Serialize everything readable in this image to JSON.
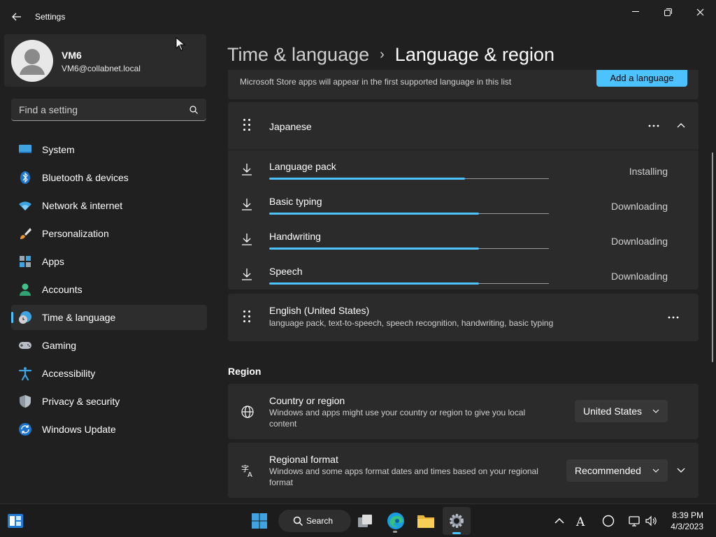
{
  "window": {
    "title": "Settings",
    "colors": {
      "accent": "#4cc2ff",
      "background": "#202020",
      "card": "#2b2b2b"
    }
  },
  "profile": {
    "name": "VM6",
    "email": "VM6@collabnet.local"
  },
  "search": {
    "placeholder": "Find a setting"
  },
  "sidebar": {
    "items": [
      {
        "label": "System",
        "icon": "system-monitor-icon"
      },
      {
        "label": "Bluetooth & devices",
        "icon": "bluetooth-icon"
      },
      {
        "label": "Network & internet",
        "icon": "wifi-icon"
      },
      {
        "label": "Personalization",
        "icon": "paintbrush-icon"
      },
      {
        "label": "Apps",
        "icon": "apps-icon"
      },
      {
        "label": "Accounts",
        "icon": "accounts-icon"
      },
      {
        "label": "Time & language",
        "icon": "time-language-icon",
        "selected": true
      },
      {
        "label": "Gaming",
        "icon": "gamepad-icon"
      },
      {
        "label": "Accessibility",
        "icon": "accessibility-icon"
      },
      {
        "label": "Privacy & security",
        "icon": "shield-icon"
      },
      {
        "label": "Windows Update",
        "icon": "update-icon"
      }
    ]
  },
  "breadcrumb": {
    "parent": "Time & language",
    "separator": "›",
    "current": "Language & region"
  },
  "preferred_languages": {
    "description": "Microsoft Store apps will appear in the first supported language in this list",
    "add_button": "Add a language",
    "languages": [
      {
        "name": "Japanese",
        "expanded": true,
        "features": [
          {
            "label": "Language pack",
            "status": "Installing",
            "progress": 0.7
          },
          {
            "label": "Basic typing",
            "status": "Downloading",
            "progress": 0.75
          },
          {
            "label": "Handwriting",
            "status": "Downloading",
            "progress": 0.75
          },
          {
            "label": "Speech",
            "status": "Downloading",
            "progress": 0.75
          }
        ]
      },
      {
        "name": "English (United States)",
        "details": "language pack, text-to-speech, speech recognition, handwriting, basic typing"
      }
    ]
  },
  "region": {
    "section_title": "Region",
    "country": {
      "title": "Country or region",
      "description_line1": "Windows and apps might use your country or region to give you local",
      "description_line2": "content",
      "value": "United States"
    },
    "format": {
      "title": "Regional format",
      "description_line1": "Windows and some apps format dates and times based on your regional",
      "description_line2": "format",
      "value": "Recommended"
    }
  },
  "taskbar": {
    "search_label": "Search",
    "time": "8:39 PM",
    "date": "4/3/2023"
  }
}
